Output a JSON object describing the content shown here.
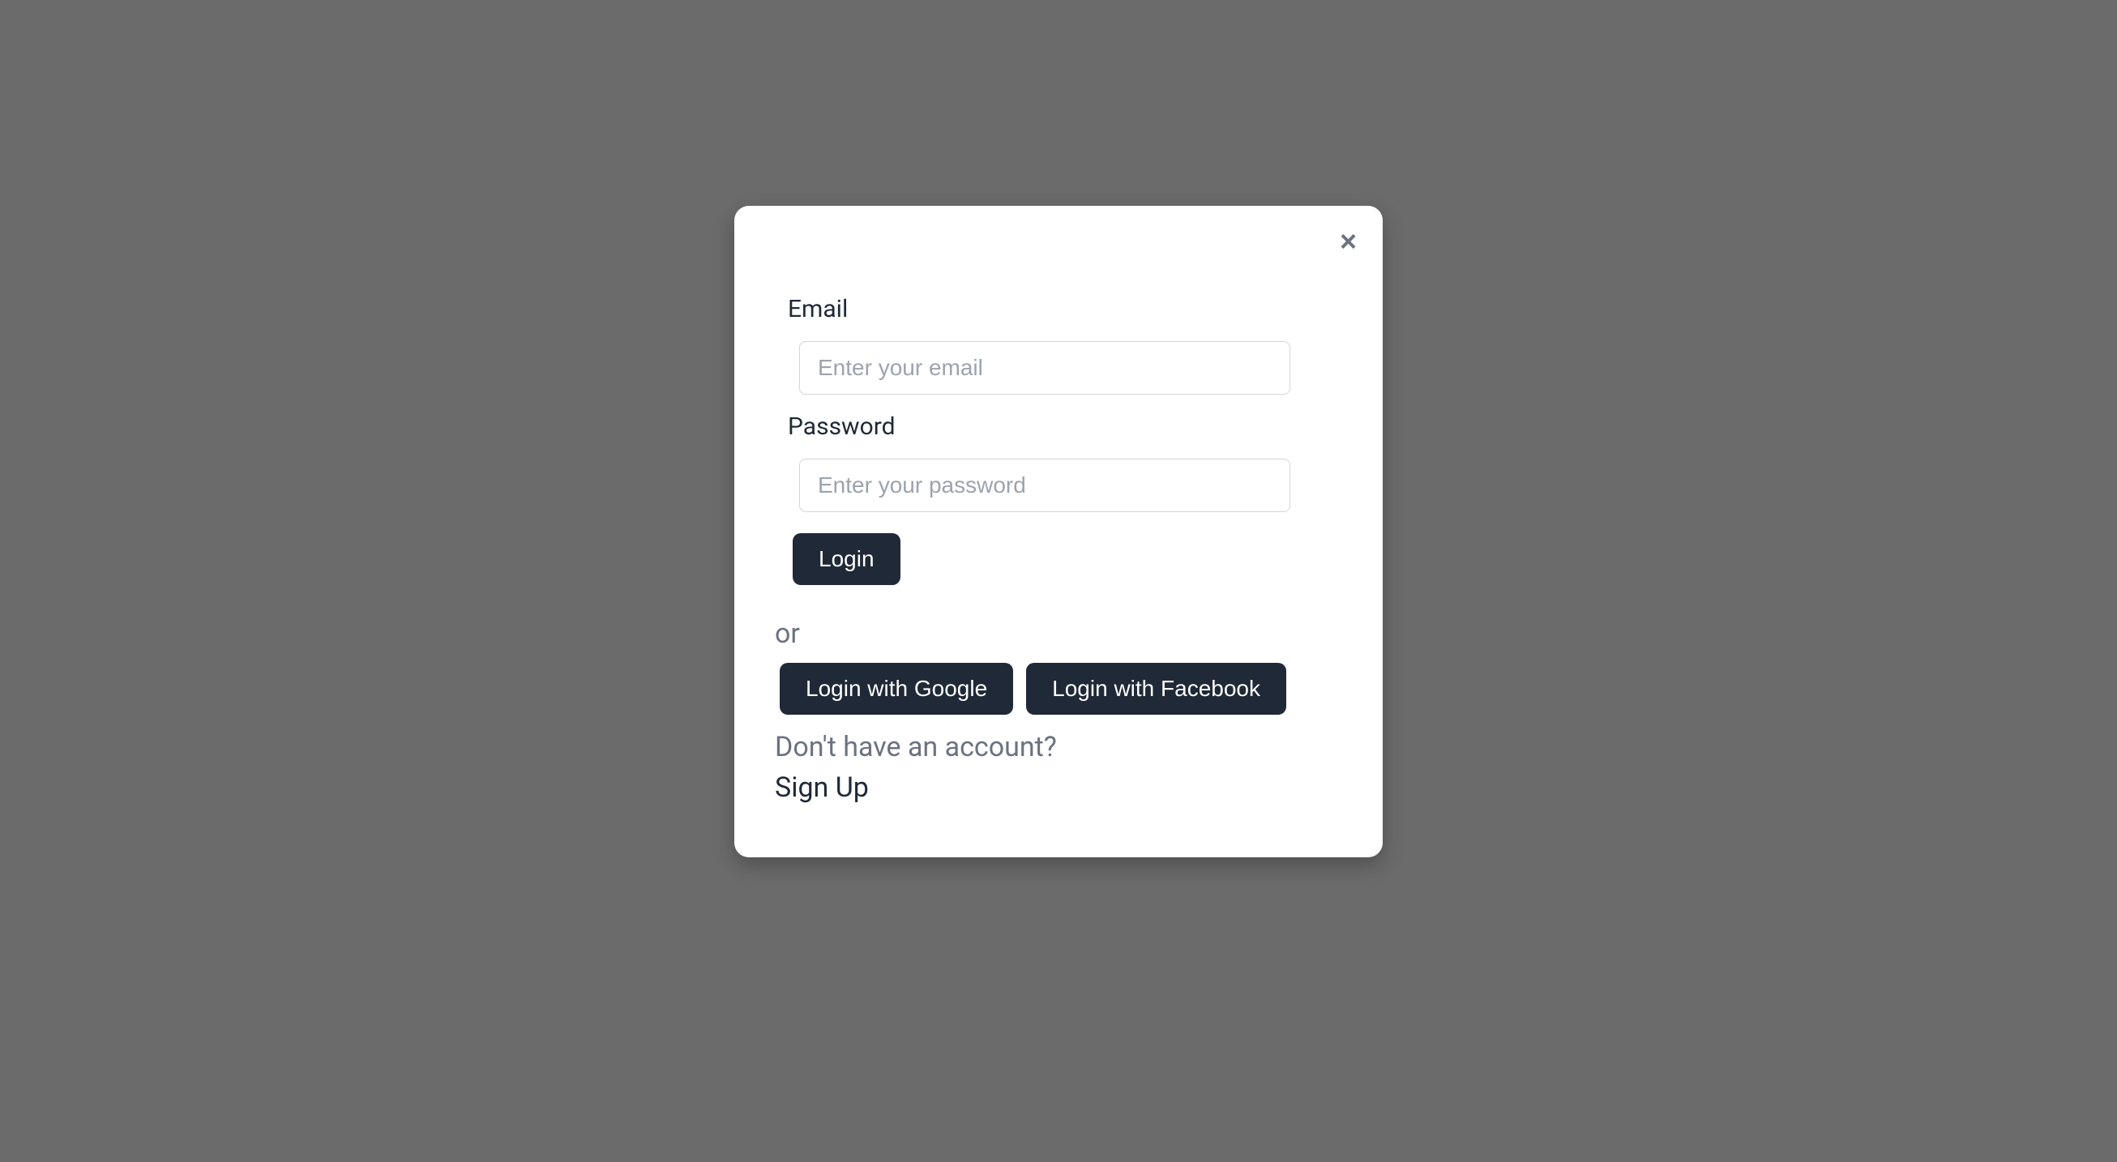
{
  "modal": {
    "close_icon": "×",
    "email": {
      "label": "Email",
      "placeholder": "Enter your email",
      "value": ""
    },
    "password": {
      "label": "Password",
      "placeholder": "Enter your password",
      "value": ""
    },
    "login_button": "Login",
    "divider": "or",
    "social": {
      "google": "Login with Google",
      "facebook": "Login with Facebook"
    },
    "signup_prompt": "Don't have an account?",
    "signup_link": "Sign Up"
  }
}
